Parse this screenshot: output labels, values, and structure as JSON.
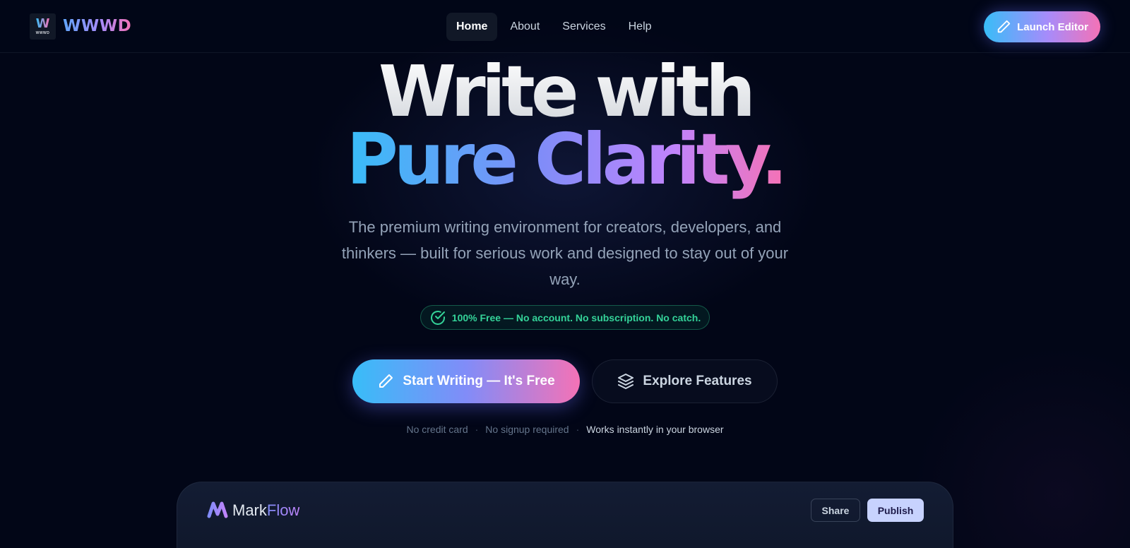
{
  "nav": {
    "logo_mark": "W",
    "logo_subtext": "WWWD",
    "brand": "WWWD",
    "links": [
      {
        "label": "Home",
        "active": true
      },
      {
        "label": "About",
        "active": false
      },
      {
        "label": "Services",
        "active": false
      },
      {
        "label": "Help",
        "active": false
      }
    ],
    "launch_label": "Launch Editor",
    "launch_icon": "pencil-icon"
  },
  "hero": {
    "line1": "Write with",
    "line2": "Pure Clarity.",
    "subtitle": "The premium writing environment for creators, developers, and thinkers — built for serious work and designed to stay out of your way.",
    "badge": "100% Free — No account. No subscription. No catch.",
    "badge_icon": "check-circle-icon",
    "primary_cta": "Start Writing — It's Free",
    "primary_icon": "pencil-icon",
    "secondary_cta": "Explore Features",
    "secondary_icon": "layers-icon",
    "assurances": [
      "No credit card",
      "No signup required",
      "Works instantly in your browser"
    ],
    "separator": "·"
  },
  "preview": {
    "app_name_part1": "Mark",
    "app_name_part2": "Flow",
    "logo_icon": "markflow-logo-icon",
    "share_label": "Share",
    "publish_label": "Publish"
  },
  "colors": {
    "background": "#020617",
    "gradient_start": "#38bdf8",
    "gradient_mid": "#818cf8",
    "gradient_end": "#f472b6",
    "badge_green": "#34d399"
  }
}
